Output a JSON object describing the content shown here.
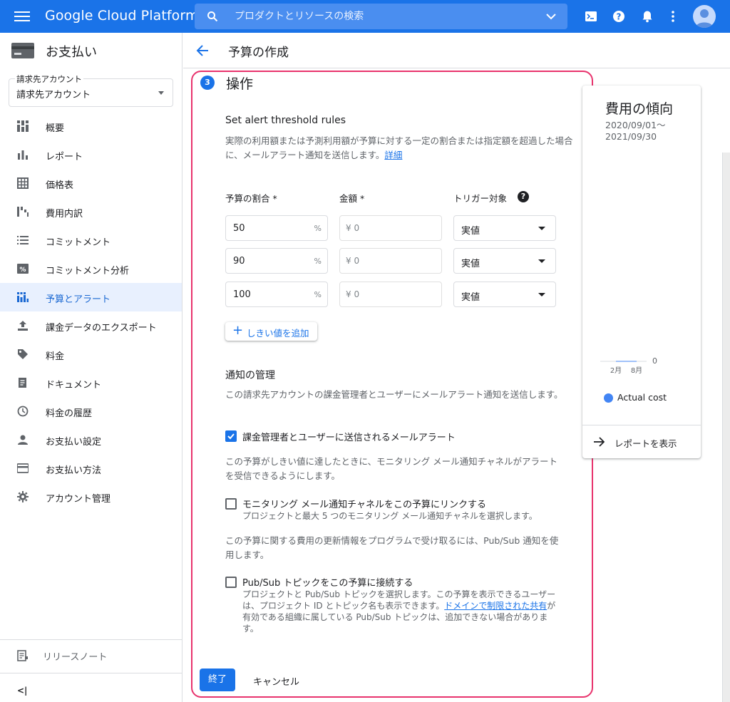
{
  "topbar": {
    "logo": "Google Cloud Platform",
    "search_placeholder": "プロダクトとリソースの検索",
    "icons": [
      "menu-icon",
      "search-icon",
      "chevron-down-icon",
      "cloud-shell-icon",
      "help-icon",
      "notifications-icon",
      "more-vert-icon",
      "avatar-icon"
    ]
  },
  "sidebar": {
    "title": "お支払い",
    "account_label": "請求先アカウント",
    "account_value": "請求先アカウント",
    "items": [
      {
        "label": "概要",
        "icon": "dashboard-icon"
      },
      {
        "label": "レポート",
        "icon": "bar-chart-icon"
      },
      {
        "label": "価格表",
        "icon": "table-icon"
      },
      {
        "label": "費用内訳",
        "icon": "waterfall-icon"
      },
      {
        "label": "コミットメント",
        "icon": "list-icon"
      },
      {
        "label": "コミットメント分析",
        "icon": "percent-icon"
      },
      {
        "label": "予算とアラート",
        "icon": "budget-icon",
        "active": true
      },
      {
        "label": "課金データのエクスポート",
        "icon": "export-icon"
      },
      {
        "label": "料金",
        "icon": "tag-icon"
      },
      {
        "label": "ドキュメント",
        "icon": "document-icon"
      },
      {
        "label": "料金の履歴",
        "icon": "history-icon"
      },
      {
        "label": "お支払い設定",
        "icon": "person-icon"
      },
      {
        "label": "お支払い方法",
        "icon": "credit-card-icon"
      },
      {
        "label": "アカウント管理",
        "icon": "gear-icon"
      }
    ],
    "release_notes": "リリースノート",
    "collapse_label": "<|"
  },
  "header": {
    "title": "予算の作成"
  },
  "form": {
    "step_number": "3",
    "step_title": "操作",
    "threshold_title": "Set alert threshold rules",
    "threshold_desc_line1": "実際の利用額または予測利用額が予算に対する一定の割合または指定額を超過した場合",
    "threshold_desc_line2": "に、メールアラート通知を送信します。",
    "details_link": "詳細",
    "col_percent": "予算の割合 *",
    "col_amount": "金額 *",
    "col_trigger": "トリガー対象",
    "percent_suffix": "%",
    "amount_prefix": "¥ 0",
    "rows": [
      {
        "percent": "50",
        "trigger": "実値"
      },
      {
        "percent": "90",
        "trigger": "実値"
      },
      {
        "percent": "100",
        "trigger": "実値"
      }
    ],
    "add_threshold": "しきい値を追加",
    "notify_title": "通知の管理",
    "notify_desc": "この請求先アカウントの課金管理者とユーザーにメールアラート通知を送信します。",
    "email_alert_label": "課金管理者とユーザーに送信されるメールアラート",
    "monitoring_desc": "この予算がしきい値に達したときに、モニタリング メール通知チャネルがアラートを受信できるようにします。",
    "monitoring_label": "モニタリング メール通知チャネルをこの予算にリンクする",
    "monitoring_sub": "プロジェクトと最大 5 つのモニタリング メール通知チャネルを選択します。",
    "pubsub_desc": "この予算に関する費用の更新情報をプログラムで受け取るには、Pub/Sub 通知を使用します。",
    "pubsub_label": "Pub/Sub トピックをこの予算に接続する",
    "pubsub_sub_a": "プロジェクトと Pub/Sub トピックを選択します。この予算を表示できるユーザーは、プロジェクト ID とトピック名も表示できます。",
    "pubsub_link": "ドメインで制限された共有",
    "pubsub_sub_b": "が有効である組織に属している Pub/Sub トピックは、追加できない場合があります。",
    "done": "終了",
    "cancel": "キャンセル"
  },
  "trend": {
    "title": "費用の傾向",
    "range_line1": "2020/09/01〜",
    "range_line2": "2021/09/30",
    "report_link": "レポートを表示",
    "legend": "Actual cost"
  },
  "chart_data": {
    "type": "line",
    "categories": [
      "2月",
      "8月"
    ],
    "series": [
      {
        "name": "Actual cost",
        "values": [
          0,
          0
        ]
      }
    ],
    "yticks": [
      "0"
    ],
    "ylim": [
      0,
      0
    ],
    "color": "#4285f4"
  },
  "colors": {
    "accent": "#1a73e8",
    "highlight_frame": "#e8336d",
    "active_nav_bg": "#e8f0fe"
  }
}
